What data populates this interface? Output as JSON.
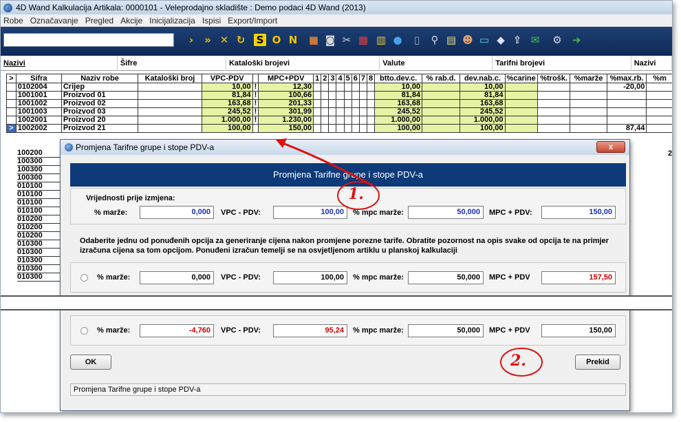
{
  "window": {
    "title": "4D Wand Kalkulacija Artikala: 0000101 - Veleprodajno skladište : Demo podaci 4D Wand (2013)"
  },
  "menu": [
    "Robe",
    "Označavanje",
    "Pregled",
    "Akcije",
    "Inicijalizacija",
    "Ispisi",
    "Export/Import"
  ],
  "toolbar": {
    "search_value": "",
    "icons": [
      "next-icon",
      "fast-forward-icon",
      "close-x-icon",
      "refresh-icon",
      "s-icon",
      "o-icon",
      "n-icon",
      "package-icon",
      "camera-icon",
      "tools-icon",
      "calculator-icon",
      "chart-icon",
      "globe-icon",
      "trash-icon",
      "search-icon",
      "docs-icon",
      "user-icon",
      "card-icon",
      "tag-icon",
      "export-icon",
      "chat-icon",
      "settings-icon",
      "green-arrow-icon"
    ],
    "text_buttons": [
      "S",
      "O",
      "N"
    ]
  },
  "tabs": [
    {
      "label": "Nazivi"
    },
    {
      "label": "Šifre"
    },
    {
      "label": "Kataloški brojevi"
    },
    {
      "label": "Valute"
    },
    {
      "label": "Tarifni brojevi"
    },
    {
      "label": "Nazivi"
    }
  ],
  "grid": {
    "columns": [
      ">",
      "Sifra",
      "Naziv robe",
      "Kataloški broj",
      "VPC-PDV",
      "",
      "MPC+PDV",
      "1",
      "2",
      "3",
      "4",
      "5",
      "6",
      "7",
      "8",
      "btto.dev.c.",
      "% rab.d.",
      "dev.nab.c.",
      "%carine",
      "%trošk.",
      "%marže",
      "%max.rb.",
      "%m"
    ],
    "rows": [
      {
        "sel": "",
        "sifra": "0102004",
        "naziv": "Crijep",
        "kat": "",
        "vpc": "10,00",
        "flag": "!",
        "mpc": "12,30",
        "btto": "10,00",
        "rab": "",
        "nab": "10,00",
        "carine": "",
        "trosk": "",
        "marze": "",
        "maxrb": "-20,00"
      },
      {
        "sel": "",
        "sifra": "1001001",
        "naziv": "Proizvod 01",
        "kat": "",
        "vpc": "81,84",
        "flag": "!",
        "mpc": "100,66",
        "btto": "81,84",
        "rab": "",
        "nab": "81,84",
        "carine": "",
        "trosk": "",
        "marze": "",
        "maxrb": ""
      },
      {
        "sel": "",
        "sifra": "1001002",
        "naziv": "Proizvod 02",
        "kat": "",
        "vpc": "163,68",
        "flag": "!",
        "mpc": "201,33",
        "btto": "163,68",
        "rab": "",
        "nab": "163,68",
        "carine": "",
        "trosk": "",
        "marze": "",
        "maxrb": ""
      },
      {
        "sel": "",
        "sifra": "1001003",
        "naziv": "Proizvod 03",
        "kat": "",
        "vpc": "245,52",
        "flag": "!",
        "mpc": "301,99",
        "btto": "245,52",
        "rab": "",
        "nab": "245,52",
        "carine": "",
        "trosk": "",
        "marze": "",
        "maxrb": ""
      },
      {
        "sel": "",
        "sifra": "1002001",
        "naziv": "Proizvod 20",
        "kat": "",
        "vpc": "1.000,00",
        "flag": "!",
        "mpc": "1.230,00",
        "btto": "1.000,00",
        "rab": "",
        "nab": "1.000,00",
        "carine": "",
        "trosk": "",
        "marze": "",
        "maxrb": ""
      },
      {
        "sel": ">",
        "sifra": "1002002",
        "naziv": "Proizvod 21",
        "kat": "",
        "vpc": "100,00",
        "flag": "",
        "mpc": "150,00",
        "btto": "100,00",
        "rab": "",
        "nab": "100,00",
        "carine": "",
        "trosk": "",
        "marze": "",
        "maxrb": "87,44"
      }
    ],
    "hidden_codes": [
      "100200",
      "100300",
      "100300",
      "100300",
      "010100",
      "010100",
      "010100",
      "010100",
      "010200",
      "010200",
      "010200",
      "010300",
      "010300",
      "010300",
      "010300",
      "010300"
    ],
    "right_edge_digit": "2"
  },
  "dialog": {
    "title": "Promjena Tarifne grupe i stope PDV-a",
    "close_label": "x",
    "banner": "Promjena Tarifne grupe i stope PDV-a",
    "before_heading": "Vrijednosti prije izmjena:",
    "labels": {
      "marze": "% marže:",
      "vpc_pdv": "VPC - PDV:",
      "mpc_marze": "% mpc marže:",
      "mpc_pdv_colon": "MPC + PDV:",
      "mpc_pdv": "MPC + PDV"
    },
    "before": {
      "marze": "0,000",
      "vpc": "100,00",
      "mpc_marze": "50,000",
      "mpc": "150,00"
    },
    "description": "Odaberite jednu od ponuđenih opcija za generiranje cijena nakon promjene porezne tarife. Obratite pozornost na opis svake od opcija te na primjer izračuna cijena sa tom opcijom. Ponuđeni izračun temelji se na osvjetljenom artiklu u planskoj kalkulaciji",
    "option1": {
      "marze": "0,000",
      "vpc": "100,00",
      "mpc_marze": "50,000",
      "mpc": "157,50"
    },
    "option2": {
      "marze": "-4,760",
      "vpc": "95,24",
      "mpc_marze": "50,000",
      "mpc": "150,00"
    },
    "ok_label": "OK",
    "cancel_label": "Prekid",
    "status": "Promjena Tarifne grupe i stope PDV-a"
  },
  "annotations": {
    "step1": "1.",
    "step2": "2."
  },
  "colors": {
    "banner": "#0d3a78",
    "highlight_cells": "#e6f3a5",
    "annotation_red": "#dd1111"
  }
}
